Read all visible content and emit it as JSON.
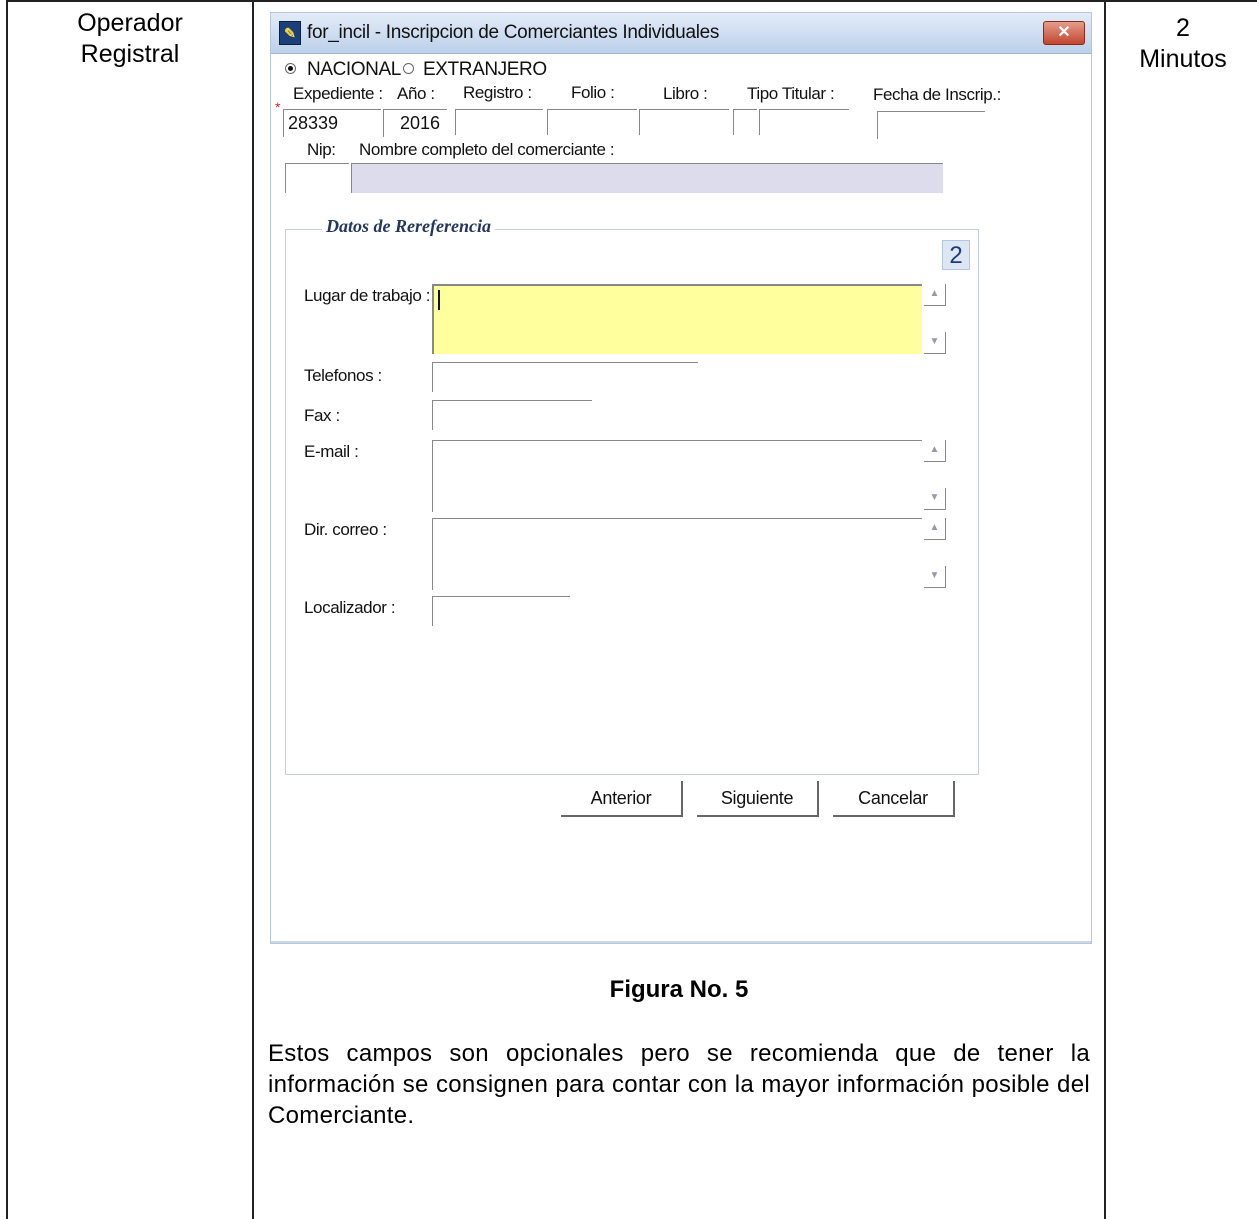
{
  "left_cell": {
    "line1": "Operador",
    "line2": "Registral"
  },
  "right_cell": {
    "line1": "2",
    "line2": "Minutos"
  },
  "window": {
    "title": "for_incil - Inscripcion de Comerciantes Individuales",
    "close_symbol": "✕",
    "radio_nacional": "NACIONAL",
    "radio_extranjero": "EXTRANJERO",
    "labels": {
      "expediente": "Expediente :",
      "anio": "Año :",
      "registro": "Registro :",
      "folio": "Folio :",
      "libro": "Libro :",
      "tipo_titular": "Tipo Titular :",
      "fecha_inscrip": "Fecha de Inscrip.:",
      "nip": "Nip:",
      "nombre": "Nombre completo del comerciante :"
    },
    "values": {
      "expediente": "28339",
      "anio": "2016",
      "registro": "",
      "folio": "",
      "libro": "",
      "tipo_titular_code": "",
      "tipo_titular": "",
      "fecha_inscrip": "",
      "nip": "",
      "nombre": ""
    },
    "required_marker": "*",
    "group": {
      "title": "Datos de Rereferencia",
      "page_number": "2",
      "lugar_label": "Lugar de trabajo :",
      "telefonos_label": "Telefonos :",
      "fax_label": "Fax :",
      "email_label": "E-mail :",
      "dir_correo_label": "Dir. correo :",
      "localizador_label": "Localizador :",
      "lugar_value": "",
      "telefonos_value": "",
      "fax_value": "",
      "email_value": "",
      "dir_correo_value": "",
      "localizador_value": ""
    },
    "buttons": {
      "anterior": "Anterior",
      "siguiente": "Siguiente",
      "cancelar": "Cancelar"
    }
  },
  "caption": "Figura No. 5",
  "description": "Estos campos son opcionales pero se recomienda que de tener la información se consignen para contar con la mayor información posible del Comerciante.",
  "colors": {
    "highlight_field": "#ffff9e",
    "disabled_field": "#dcdcec",
    "titlebar": "#c9d9ee"
  }
}
